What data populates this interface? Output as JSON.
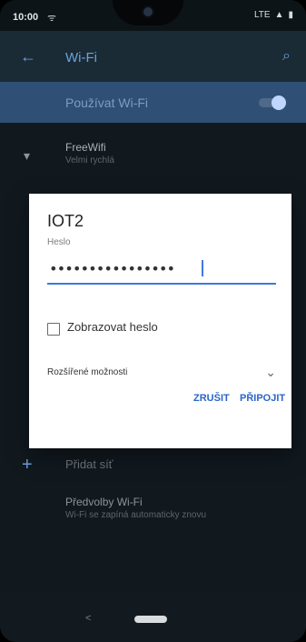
{
  "status_bar": {
    "time": "10:00",
    "left_icon": "ᯤ",
    "right_icon_text": "LTE"
  },
  "app_bar": {
    "title": "Wi-Fi",
    "back_icon": "←",
    "search_icon": "⌕"
  },
  "wifi_toggle": {
    "label": "Používat Wi-Fi"
  },
  "networks": [
    {
      "name": "FreeWifi",
      "subtitle": "Velmi rychlá"
    }
  ],
  "list_footer": {
    "add_network": "Přidat síť",
    "preferences_title": "Předvolby Wi-Fi",
    "preferences_subtitle": "Wi-Fi se zapíná automaticky znovu"
  },
  "dialog": {
    "title": "IOT2",
    "password_label": "Heslo",
    "password_masked": "••••••••••••••••",
    "show_password_label": "Zobrazovat heslo",
    "advanced_label": "Rozšířené možnosti",
    "cancel_label": "ZRUŠIT",
    "connect_label": "PŘIPOJIT"
  },
  "nav_bar": {
    "back": "<"
  },
  "colors": {
    "accent": "#3f78df",
    "appbar": "#1a2b35",
    "wifi_enabled_row": "#2f4f75",
    "dialog_background": "#ffffff"
  }
}
